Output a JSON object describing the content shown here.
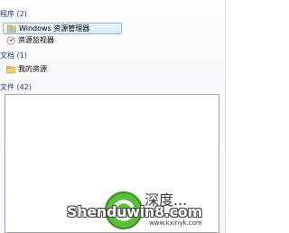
{
  "groups": {
    "programs": {
      "title": "程序 (2)"
    },
    "documents": {
      "title": "文档 (1)"
    },
    "files": {
      "title": "文件 (42)"
    }
  },
  "items": {
    "windows_explorer": {
      "label": "Windows 资源管理器",
      "icon": "folder-explorer-icon"
    },
    "resource_monitor": {
      "label": "资源监视器",
      "icon": "resource-monitor-icon"
    },
    "my_resources": {
      "label": "我的资源",
      "icon": "folder-icon"
    }
  },
  "watermark": {
    "brand": "Shenduwin8.com",
    "chinese": "深度...",
    "url": "www.kxinyk.com"
  },
  "colors": {
    "group_header": "#1e3287",
    "selection_border": "#88b6e3",
    "selection_fill": "#d9ebfb"
  }
}
